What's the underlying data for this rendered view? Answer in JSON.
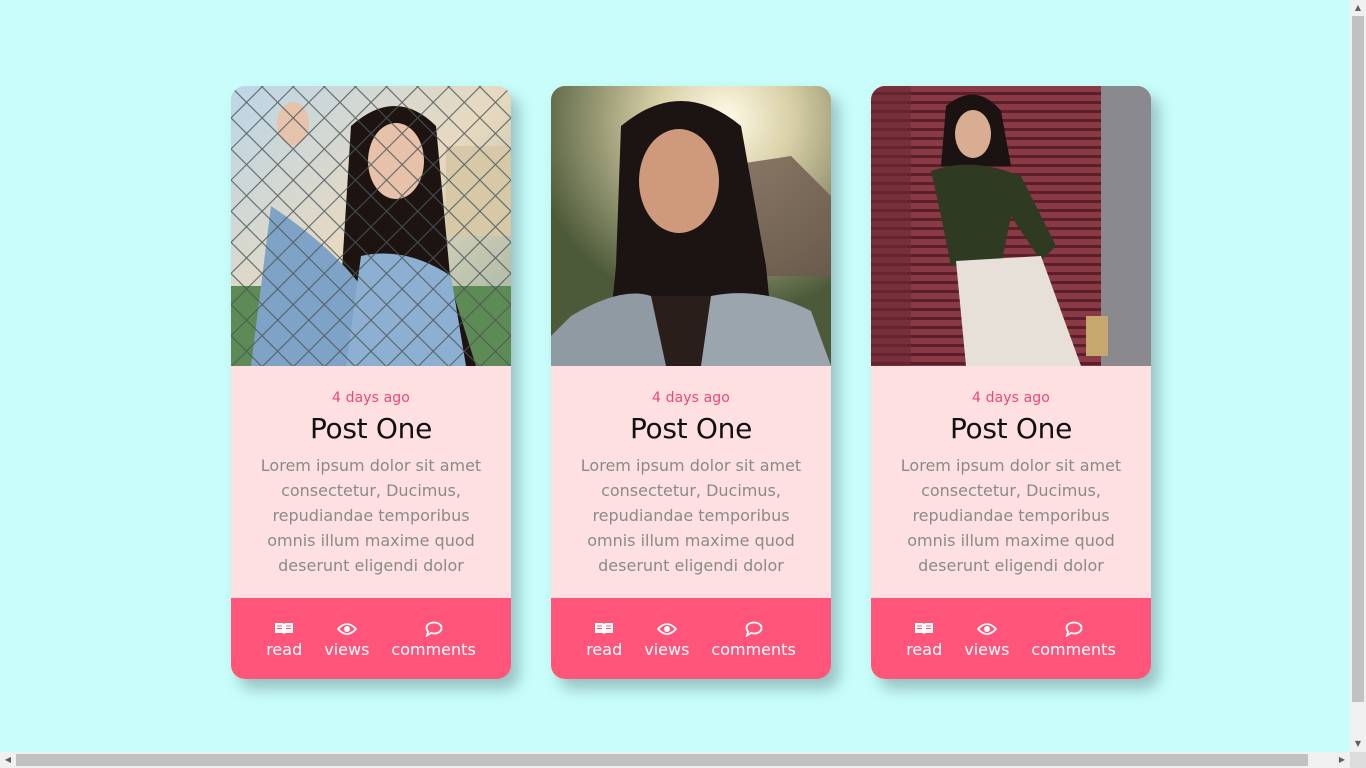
{
  "cards": [
    {
      "photo": "woman-behind-chain-link-fence",
      "date": "4 days ago",
      "title": "Post One",
      "text": "Lorem ipsum dolor sit amet consectetur, Ducimus, repudiandae temporibus omnis illum maxime quod deserunt eligendi dolor",
      "stats": {
        "read": "read",
        "views": "views",
        "comments": "comments"
      }
    },
    {
      "photo": "woman-in-denim-jacket-sunlight",
      "date": "4 days ago",
      "title": "Post One",
      "text": "Lorem ipsum dolor sit amet consectetur, Ducimus, repudiandae temporibus omnis illum maxime quod deserunt eligendi dolor",
      "stats": {
        "read": "read",
        "views": "views",
        "comments": "comments"
      }
    },
    {
      "photo": "woman-leaning-on-red-shutter",
      "date": "4 days ago",
      "title": "Post One",
      "text": "Lorem ipsum dolor sit amet consectetur, Ducimus, repudiandae temporibus omnis illum maxime quod deserunt eligendi dolor",
      "stats": {
        "read": "read",
        "views": "views",
        "comments": "comments"
      }
    }
  ],
  "icons": {
    "read": "book-open-icon",
    "views": "eye-icon",
    "comments": "speech-bubble-icon"
  },
  "colors": {
    "background": "#c8fdfa",
    "card_body": "#ffe0e2",
    "footer": "#ff557a",
    "date": "#f0476d",
    "text": "#8a8a8a"
  }
}
